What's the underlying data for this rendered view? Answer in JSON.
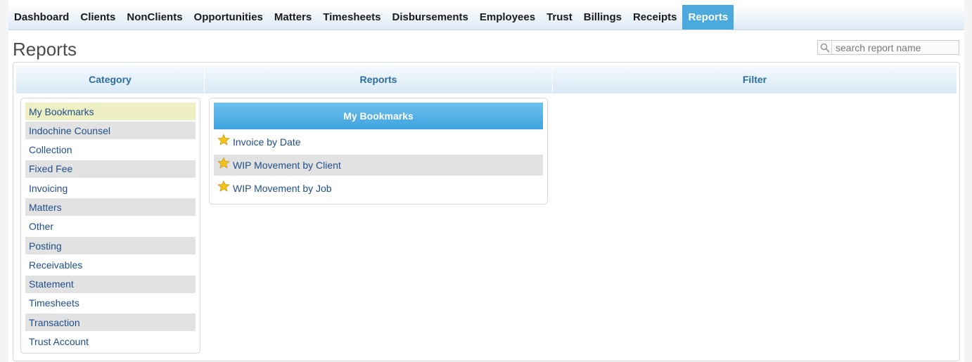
{
  "nav": {
    "items": [
      {
        "label": "Dashboard"
      },
      {
        "label": "Clients"
      },
      {
        "label": "NonClients"
      },
      {
        "label": "Opportunities"
      },
      {
        "label": "Matters"
      },
      {
        "label": "Timesheets"
      },
      {
        "label": "Disbursements"
      },
      {
        "label": "Employees"
      },
      {
        "label": "Trust"
      },
      {
        "label": "Billings"
      },
      {
        "label": "Receipts"
      },
      {
        "label": "Reports",
        "active": true
      }
    ]
  },
  "page": {
    "title": "Reports"
  },
  "search": {
    "placeholder": "search report name",
    "value": "",
    "icon": "search-icon"
  },
  "columns": {
    "category": "Category",
    "reports": "Reports",
    "filter": "Filter"
  },
  "categories": [
    {
      "label": "My Bookmarks",
      "selected": true
    },
    {
      "label": "Indochine Counsel"
    },
    {
      "label": "Collection"
    },
    {
      "label": "Fixed Fee"
    },
    {
      "label": "Invoicing"
    },
    {
      "label": "Matters"
    },
    {
      "label": "Other"
    },
    {
      "label": "Posting"
    },
    {
      "label": "Receivables"
    },
    {
      "label": "Statement"
    },
    {
      "label": "Timesheets"
    },
    {
      "label": "Transaction"
    },
    {
      "label": "Trust Account"
    }
  ],
  "reports_panel": {
    "header": "My Bookmarks",
    "items": [
      {
        "label": "Invoice by Date",
        "icon": "star-icon"
      },
      {
        "label": "WIP Movement by Client",
        "icon": "star-icon"
      },
      {
        "label": "WIP Movement by Job",
        "icon": "star-icon"
      }
    ]
  },
  "colors": {
    "nav_active": "#4aa9dd",
    "link": "#1f4e8c",
    "header_text": "#2a6d9f",
    "selected_row": "#eeefc2",
    "shaded_row": "#e2e2e2",
    "star": "#f3c21b"
  }
}
